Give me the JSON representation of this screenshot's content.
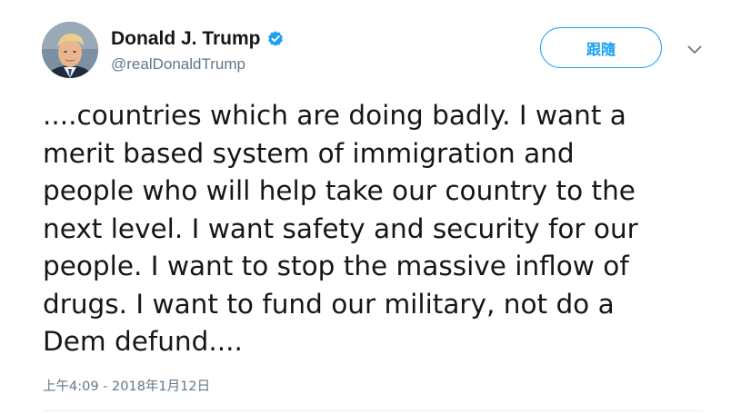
{
  "author": {
    "display_name": "Donald J. Trump",
    "handle": "@realDonaldTrump",
    "verified_icon": "verified-badge-icon",
    "avatar_icon": "profile-photo"
  },
  "actions": {
    "follow_label": "跟隨",
    "more_icon": "chevron-down-icon"
  },
  "tweet": {
    "text": "....countries which are doing badly. I want a\nmerit based system of immigration and\npeople who will help take our country to the\nnext level. I want safety and security for our\npeople. I want to stop the massive inflow of\ndrugs. I want to fund our military, not do a\nDem defund....",
    "timestamp": "上午4:09 - 2018年1月12日"
  },
  "colors": {
    "accent": "#1da1f2",
    "text": "#14171a",
    "secondary": "#657786",
    "divider": "#e6ecf0"
  }
}
